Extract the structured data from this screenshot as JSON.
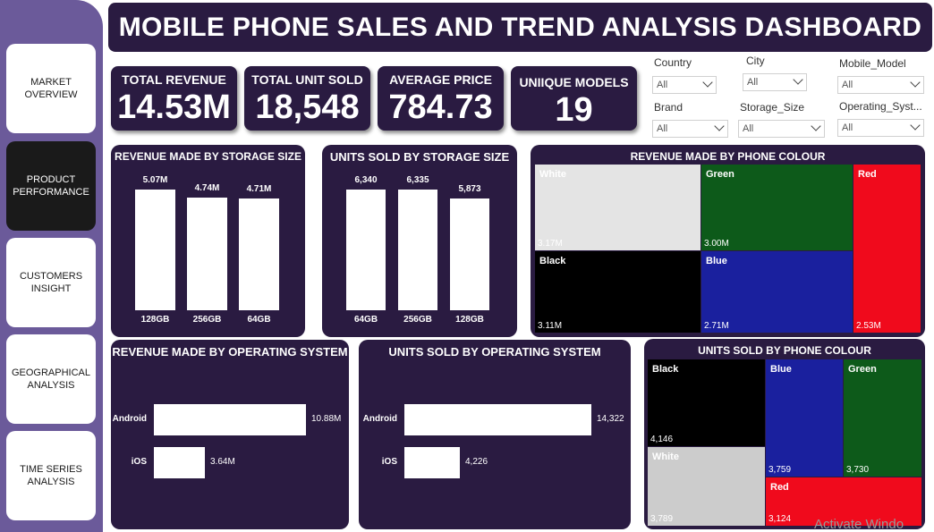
{
  "sidebar": {
    "items": [
      {
        "label": "MARKET OVERVIEW"
      },
      {
        "label": "PRODUCT PERFORMANCE"
      },
      {
        "label": "CUSTOMERS INSIGHT"
      },
      {
        "label": "GEOGRAPHICAL ANALYSIS"
      },
      {
        "label": "TIME SERIES ANALYSIS"
      }
    ],
    "active": "PRODUCT PERFORMANCE"
  },
  "header": {
    "title": "MOBILE PHONE SALES AND TREND ANALYSIS DASHBOARD"
  },
  "kpis": [
    {
      "label": "TOTAL REVENUE",
      "value": "14.53M"
    },
    {
      "label": "TOTAL UNIT SOLD",
      "value": "18,548"
    },
    {
      "label": "AVERAGE PRICE",
      "value": "784.73"
    },
    {
      "label": "UNIIQUE MODELS",
      "value": "19"
    }
  ],
  "filters": [
    {
      "label": "Country",
      "value": "All"
    },
    {
      "label": "City",
      "value": "All"
    },
    {
      "label": "Mobile_Model",
      "value": "All"
    },
    {
      "label": "Brand",
      "value": "All"
    },
    {
      "label": "Storage_Size",
      "value": "All"
    },
    {
      "label": "Operating_Syst...",
      "value": "All"
    }
  ],
  "watermark": "Activate Windo",
  "colors": {
    "panel": "#2a1b41",
    "sidebar": "#6b5a9a",
    "white": "#e4e4e4",
    "green": "#0d5a1a",
    "red": "#f00a1c",
    "black": "#000000",
    "blue": "#1a209e"
  },
  "chart_data": [
    {
      "type": "bar",
      "title": "REVENUE MADE BY STORAGE SIZE",
      "categories": [
        "128GB",
        "256GB",
        "64GB"
      ],
      "values": [
        5.07,
        4.74,
        4.71
      ],
      "value_labels": [
        "5.07M",
        "4.74M",
        "4.71M"
      ],
      "ylim": [
        0,
        5.07
      ]
    },
    {
      "type": "bar",
      "title": "UNITS SOLD BY STORAGE SIZE",
      "categories": [
        "64GB",
        "256GB",
        "128GB"
      ],
      "values": [
        6340,
        6335,
        5873
      ],
      "value_labels": [
        "6,340",
        "6,335",
        "5,873"
      ],
      "ylim": [
        0,
        6340
      ]
    },
    {
      "type": "heatmap",
      "title": "REVENUE MADE BY PHONE COLOUR",
      "categories": [
        "White",
        "Green",
        "Red",
        "Black",
        "Blue"
      ],
      "values": [
        3.17,
        3.0,
        2.53,
        3.11,
        2.71
      ],
      "value_labels": [
        "3.17M",
        "3.00M",
        "2.53M",
        "3.11M",
        "2.71M"
      ]
    },
    {
      "type": "bar",
      "title": "REVENUE MADE BY OPERATING SYSTEM",
      "categories": [
        "Android",
        "iOS"
      ],
      "values": [
        10.88,
        3.64
      ],
      "value_labels": [
        "10.88M",
        "3.64M"
      ],
      "xlim": [
        0,
        10.88
      ]
    },
    {
      "type": "bar",
      "title": "UNITS SOLD BY OPERATING SYSTEM",
      "categories": [
        "Android",
        "iOS"
      ],
      "values": [
        14322,
        4226
      ],
      "value_labels": [
        "14,322",
        "4,226"
      ],
      "xlim": [
        0,
        14322
      ]
    },
    {
      "type": "heatmap",
      "title": "UNITS SOLD BY PHONE COLOUR",
      "categories": [
        "Black",
        "Blue",
        "Green",
        "White",
        "Red"
      ],
      "values": [
        4146,
        3759,
        3730,
        3789,
        3124
      ],
      "value_labels": [
        "4,146",
        "3,759",
        "3,730",
        "3,789",
        "3,124"
      ]
    }
  ]
}
